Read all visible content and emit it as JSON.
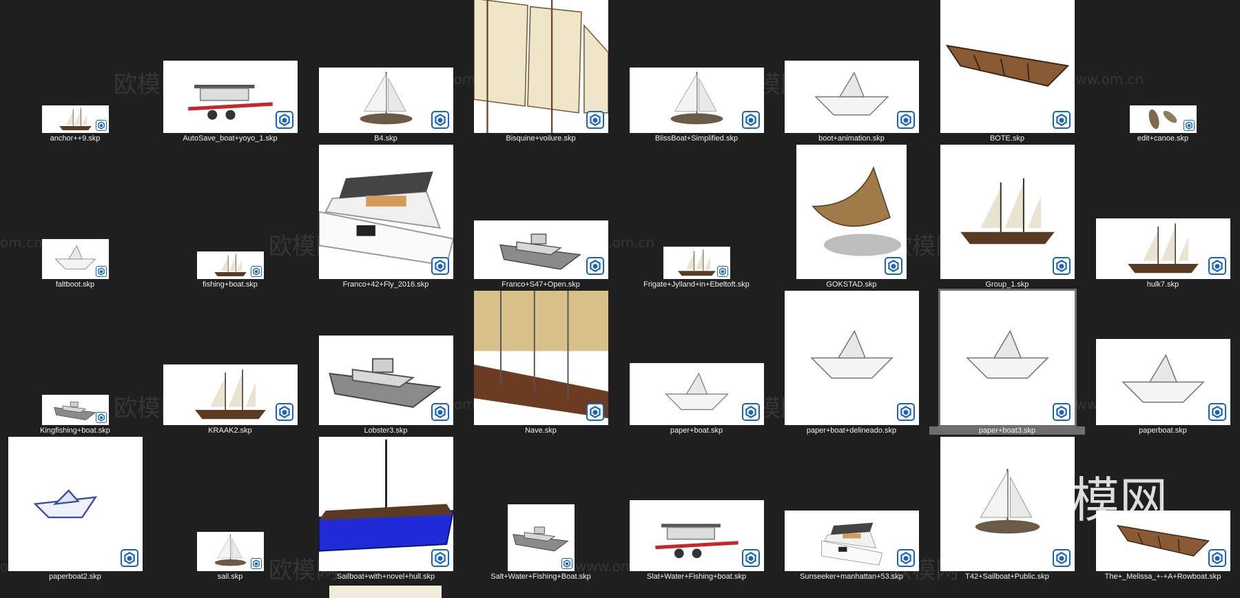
{
  "watermarks": {
    "brand": "欧模网",
    "url": "www.om.cn",
    "url_short": "om.cn",
    "big": "模网"
  },
  "colors": {
    "background": "#1f1f1f",
    "label_text": "#f0f0f0",
    "selection": "#6e6e6e",
    "badge": "#1565c0"
  },
  "files": [
    {
      "name": "anchor++9.skp",
      "icon": "sketchup-icon"
    },
    {
      "name": "AutoSave_boat+yoyo_1.skp",
      "icon": "sketchup-icon"
    },
    {
      "name": "B4.skp",
      "icon": "sketchup-icon"
    },
    {
      "name": "Bisquine+voilure.skp",
      "icon": "sketchup-icon"
    },
    {
      "name": "BlissBoat+Simplified.skp",
      "icon": "sketchup-icon"
    },
    {
      "name": "boot+animation.skp",
      "icon": "sketchup-icon"
    },
    {
      "name": "BOTE.skp",
      "icon": "sketchup-icon"
    },
    {
      "name": "edit+canoe.skp",
      "icon": "sketchup-icon"
    },
    {
      "name": "faltboot.skp",
      "icon": "sketchup-icon"
    },
    {
      "name": "fishing+boat.skp",
      "icon": "sketchup-icon"
    },
    {
      "name": "Franco+42+Fly_2016.skp",
      "icon": "sketchup-icon"
    },
    {
      "name": "Franco+S47+Open.skp",
      "icon": "sketchup-icon"
    },
    {
      "name": "Frigate+Jylland+in+Ebeltoft.skp",
      "icon": "sketchup-icon"
    },
    {
      "name": "GOKSTAD.skp",
      "icon": "sketchup-icon"
    },
    {
      "name": "Group_1.skp",
      "icon": "sketchup-icon"
    },
    {
      "name": "hulk7.skp",
      "icon": "sketchup-icon"
    },
    {
      "name": "Kingfishing+boat.skp",
      "icon": "sketchup-icon"
    },
    {
      "name": "KRAAK2.skp",
      "icon": "sketchup-icon"
    },
    {
      "name": "Lobster3.skp",
      "icon": "sketchup-icon"
    },
    {
      "name": "Nave.skp",
      "icon": "sketchup-icon"
    },
    {
      "name": "paper+boat.skp",
      "icon": "sketchup-icon"
    },
    {
      "name": "paper+boat+delineado.skp",
      "icon": "sketchup-icon"
    },
    {
      "name": "paper+boat3.skp",
      "icon": "sketchup-icon",
      "selected": true
    },
    {
      "name": "paperboat.skp",
      "icon": "sketchup-icon"
    },
    {
      "name": "paperboat2.skp",
      "icon": "sketchup-icon"
    },
    {
      "name": "sail.skp",
      "icon": "sketchup-icon"
    },
    {
      "name": "Sailboat+with+novel+hull.skp",
      "icon": "sketchup-icon"
    },
    {
      "name": "Salt+Water+Fishing+Boat.skp",
      "icon": "sketchup-icon"
    },
    {
      "name": "Slat+Water+Fishing+boat.skp",
      "icon": "sketchup-icon"
    },
    {
      "name": "Sunseeker+manhattan+53.skp",
      "icon": "sketchup-icon"
    },
    {
      "name": "T42+Sailboat+Public.skp",
      "icon": "sketchup-icon"
    },
    {
      "name": "The+_Melissa_+-+A+Rowboat.skp",
      "icon": "sketchup-icon"
    }
  ]
}
